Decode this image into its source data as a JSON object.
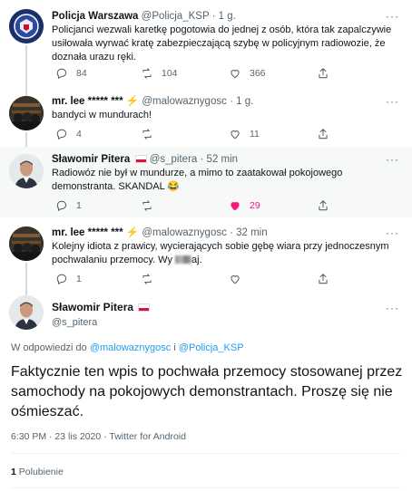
{
  "tweets": [
    {
      "name": "Policja Warszawa",
      "handle": "@Policja_KSP",
      "time": "1 g.",
      "text": "Policjanci wezwali karetkę pogotowia do jednej z osób, która tak zapalczywie usiłowała wyrwać kratę zabezpieczającą szybę w policyjnym radiowozie, że doznała urazu ręki.",
      "reply_count": "84",
      "retweet_count": "104",
      "like_count": "366"
    },
    {
      "name": "mr. lee ***** *** ⚡",
      "handle": "@malowaznygosc",
      "time": "1 g.",
      "text": "bandyci w mundurach!",
      "reply_count": "4",
      "retweet_count": "",
      "like_count": "11"
    },
    {
      "name": "Sławomir Pitera",
      "handle": "@s_pitera",
      "time": "52 min",
      "text": "Radiowóz nie był w mundurze, a mimo to zaatakował pokojowego demonstranta. SKANDAL 😂",
      "reply_count": "1",
      "retweet_count": "",
      "like_count": "29"
    },
    {
      "name": "mr. lee ***** *** ⚡",
      "handle": "@malowaznygosc",
      "time": "32 min",
      "text_before": "Kolejny idiota z prawicy, wycierających sobie gębę wiara przy jednoczesnym pochwalaniu przemocy. Wy",
      "text_after": "aj.",
      "reply_count": "1",
      "retweet_count": "",
      "like_count": ""
    }
  ],
  "main": {
    "name": "Sławomir Pitera",
    "handle": "@s_pitera",
    "reply_prefix": "W odpowiedzi do",
    "reply_user1": "@malowaznygosc",
    "reply_and": "i",
    "reply_user2": "@Policja_KSP",
    "text": "Faktycznie ten wpis to pochwała przemocy stosowanej przez samochody na pokojowych demonstrantach. Proszę się nie ośmieszać.",
    "meta": "6:30 PM · 23 lis 2020 · Twitter for Android",
    "likes_count": "1",
    "likes_label": "Polubienie"
  },
  "colors": {
    "accent": "#1d9bf0",
    "like": "#f91880",
    "secondary_text": "#536471"
  }
}
